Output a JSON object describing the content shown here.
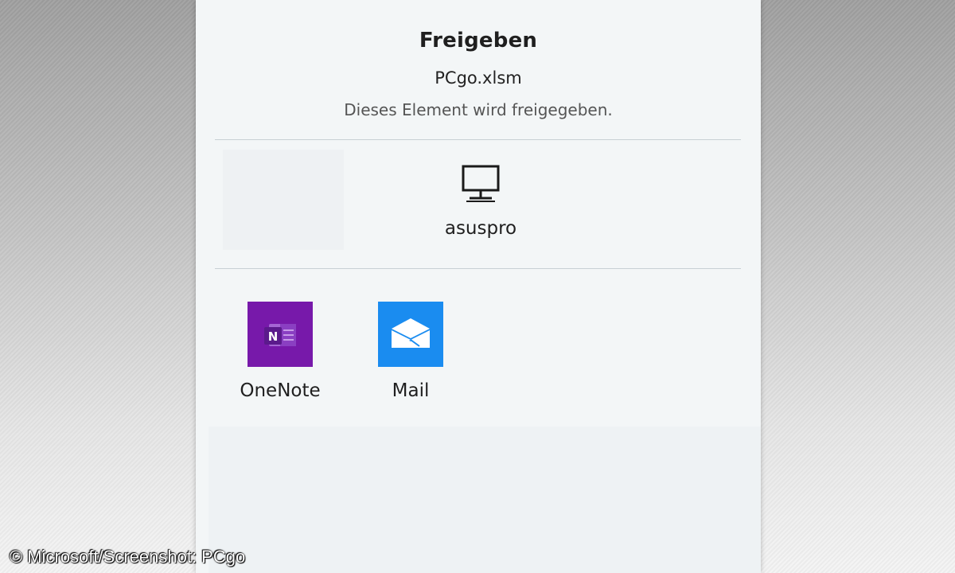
{
  "share_dialog": {
    "title": "Freigeben",
    "file_name": "PCgo.xlsm",
    "subtitle": "Dieses Element wird freigegeben.",
    "nearby_devices": [
      {
        "label": "asuspro",
        "icon": "desktop-pc-icon"
      }
    ],
    "apps": [
      {
        "label": "OneNote",
        "icon": "onenote-icon",
        "tile_color": "#7719aa"
      },
      {
        "label": "Mail",
        "icon": "mail-icon",
        "tile_color": "#1a8cf0"
      }
    ]
  },
  "watermark": {
    "text": "© Microsoft/Screenshot: PCgo"
  }
}
